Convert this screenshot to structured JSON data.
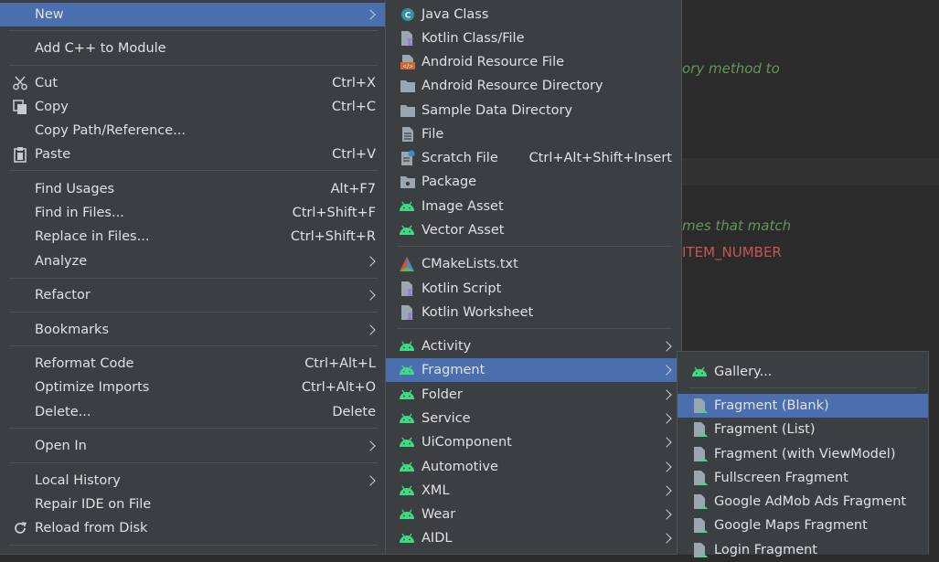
{
  "editor": {
    "line1": "ory method to",
    "line2": "mes that match",
    "line3": "ITEM_NUMBER"
  },
  "menu1": {
    "items": [
      {
        "label": "New"
      },
      {
        "label": "Add C++ to Module"
      },
      {
        "label": "Cut",
        "shortcut": "Ctrl+X"
      },
      {
        "label": "Copy",
        "shortcut": "Ctrl+C"
      },
      {
        "label": "Copy Path/Reference..."
      },
      {
        "label": "Paste",
        "shortcut": "Ctrl+V"
      },
      {
        "label": "Find Usages",
        "shortcut": "Alt+F7"
      },
      {
        "label": "Find in Files...",
        "shortcut": "Ctrl+Shift+F"
      },
      {
        "label": "Replace in Files...",
        "shortcut": "Ctrl+Shift+R"
      },
      {
        "label": "Analyze"
      },
      {
        "label": "Refactor"
      },
      {
        "label": "Bookmarks"
      },
      {
        "label": "Reformat Code",
        "shortcut": "Ctrl+Alt+L"
      },
      {
        "label": "Optimize Imports",
        "shortcut": "Ctrl+Alt+O"
      },
      {
        "label": "Delete...",
        "shortcut": "Delete"
      },
      {
        "label": "Open In"
      },
      {
        "label": "Local History"
      },
      {
        "label": "Repair IDE on File"
      },
      {
        "label": "Reload from Disk"
      }
    ]
  },
  "menu2": {
    "items": [
      {
        "label": "Java Class"
      },
      {
        "label": "Kotlin Class/File"
      },
      {
        "label": "Android Resource File"
      },
      {
        "label": "Android Resource Directory"
      },
      {
        "label": "Sample Data Directory"
      },
      {
        "label": "File"
      },
      {
        "label": "Scratch File",
        "shortcut": "Ctrl+Alt+Shift+Insert"
      },
      {
        "label": "Package"
      },
      {
        "label": "Image Asset"
      },
      {
        "label": "Vector Asset"
      },
      {
        "label": "CMakeLists.txt"
      },
      {
        "label": "Kotlin Script"
      },
      {
        "label": "Kotlin Worksheet"
      },
      {
        "label": "Activity"
      },
      {
        "label": "Fragment"
      },
      {
        "label": "Folder"
      },
      {
        "label": "Service"
      },
      {
        "label": "UiComponent"
      },
      {
        "label": "Automotive"
      },
      {
        "label": "XML"
      },
      {
        "label": "Wear"
      },
      {
        "label": "AIDL"
      }
    ]
  },
  "menu3": {
    "items": [
      {
        "label": "Gallery..."
      },
      {
        "label": "Fragment (Blank)"
      },
      {
        "label": "Fragment (List)"
      },
      {
        "label": "Fragment (with ViewModel)"
      },
      {
        "label": "Fullscreen Fragment"
      },
      {
        "label": "Google AdMob Ads Fragment"
      },
      {
        "label": "Google Maps Fragment"
      },
      {
        "label": "Login Fragment"
      }
    ]
  },
  "colors": {
    "menu_bg": "#3c3f41",
    "selection": "#4b6eaf",
    "android_green": "#3ddc84",
    "code_green": "#629755",
    "code_red": "#c75450"
  }
}
